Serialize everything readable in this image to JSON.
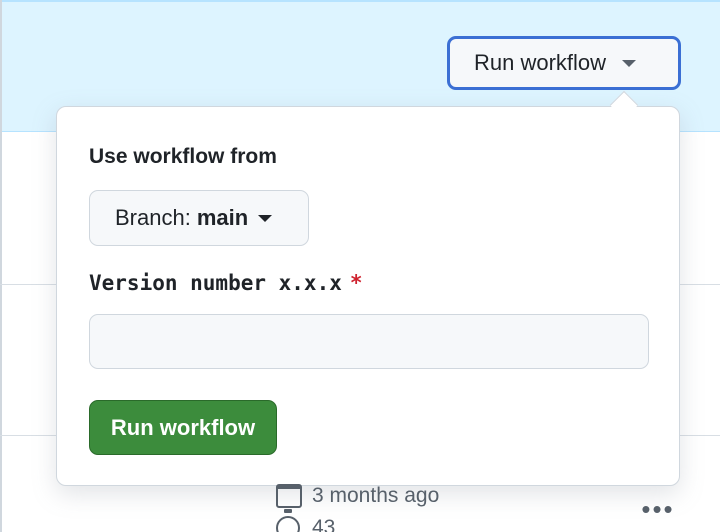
{
  "header": {
    "run_workflow_label": "Run workflow"
  },
  "popover": {
    "use_workflow_from_label": "Use workflow from",
    "branch_prefix": "Branch:",
    "branch_value": "main",
    "version_label": "Version number x.x.x",
    "required_mark": "*",
    "version_value": "",
    "submit_label": "Run workflow"
  },
  "run_row": {
    "time_ago": "3 months ago",
    "duration": "43"
  },
  "colors": {
    "band_bg": "#ddf4ff",
    "focus_border": "#3b6fd4",
    "primary_green": "#3c8c3c",
    "required_red": "#cf222e",
    "muted_text": "#57606a"
  },
  "icons": {
    "caret": "triangle-down-icon",
    "calendar": "calendar-icon",
    "stopwatch": "stopwatch-icon",
    "more": "kebab-horizontal-icon"
  }
}
